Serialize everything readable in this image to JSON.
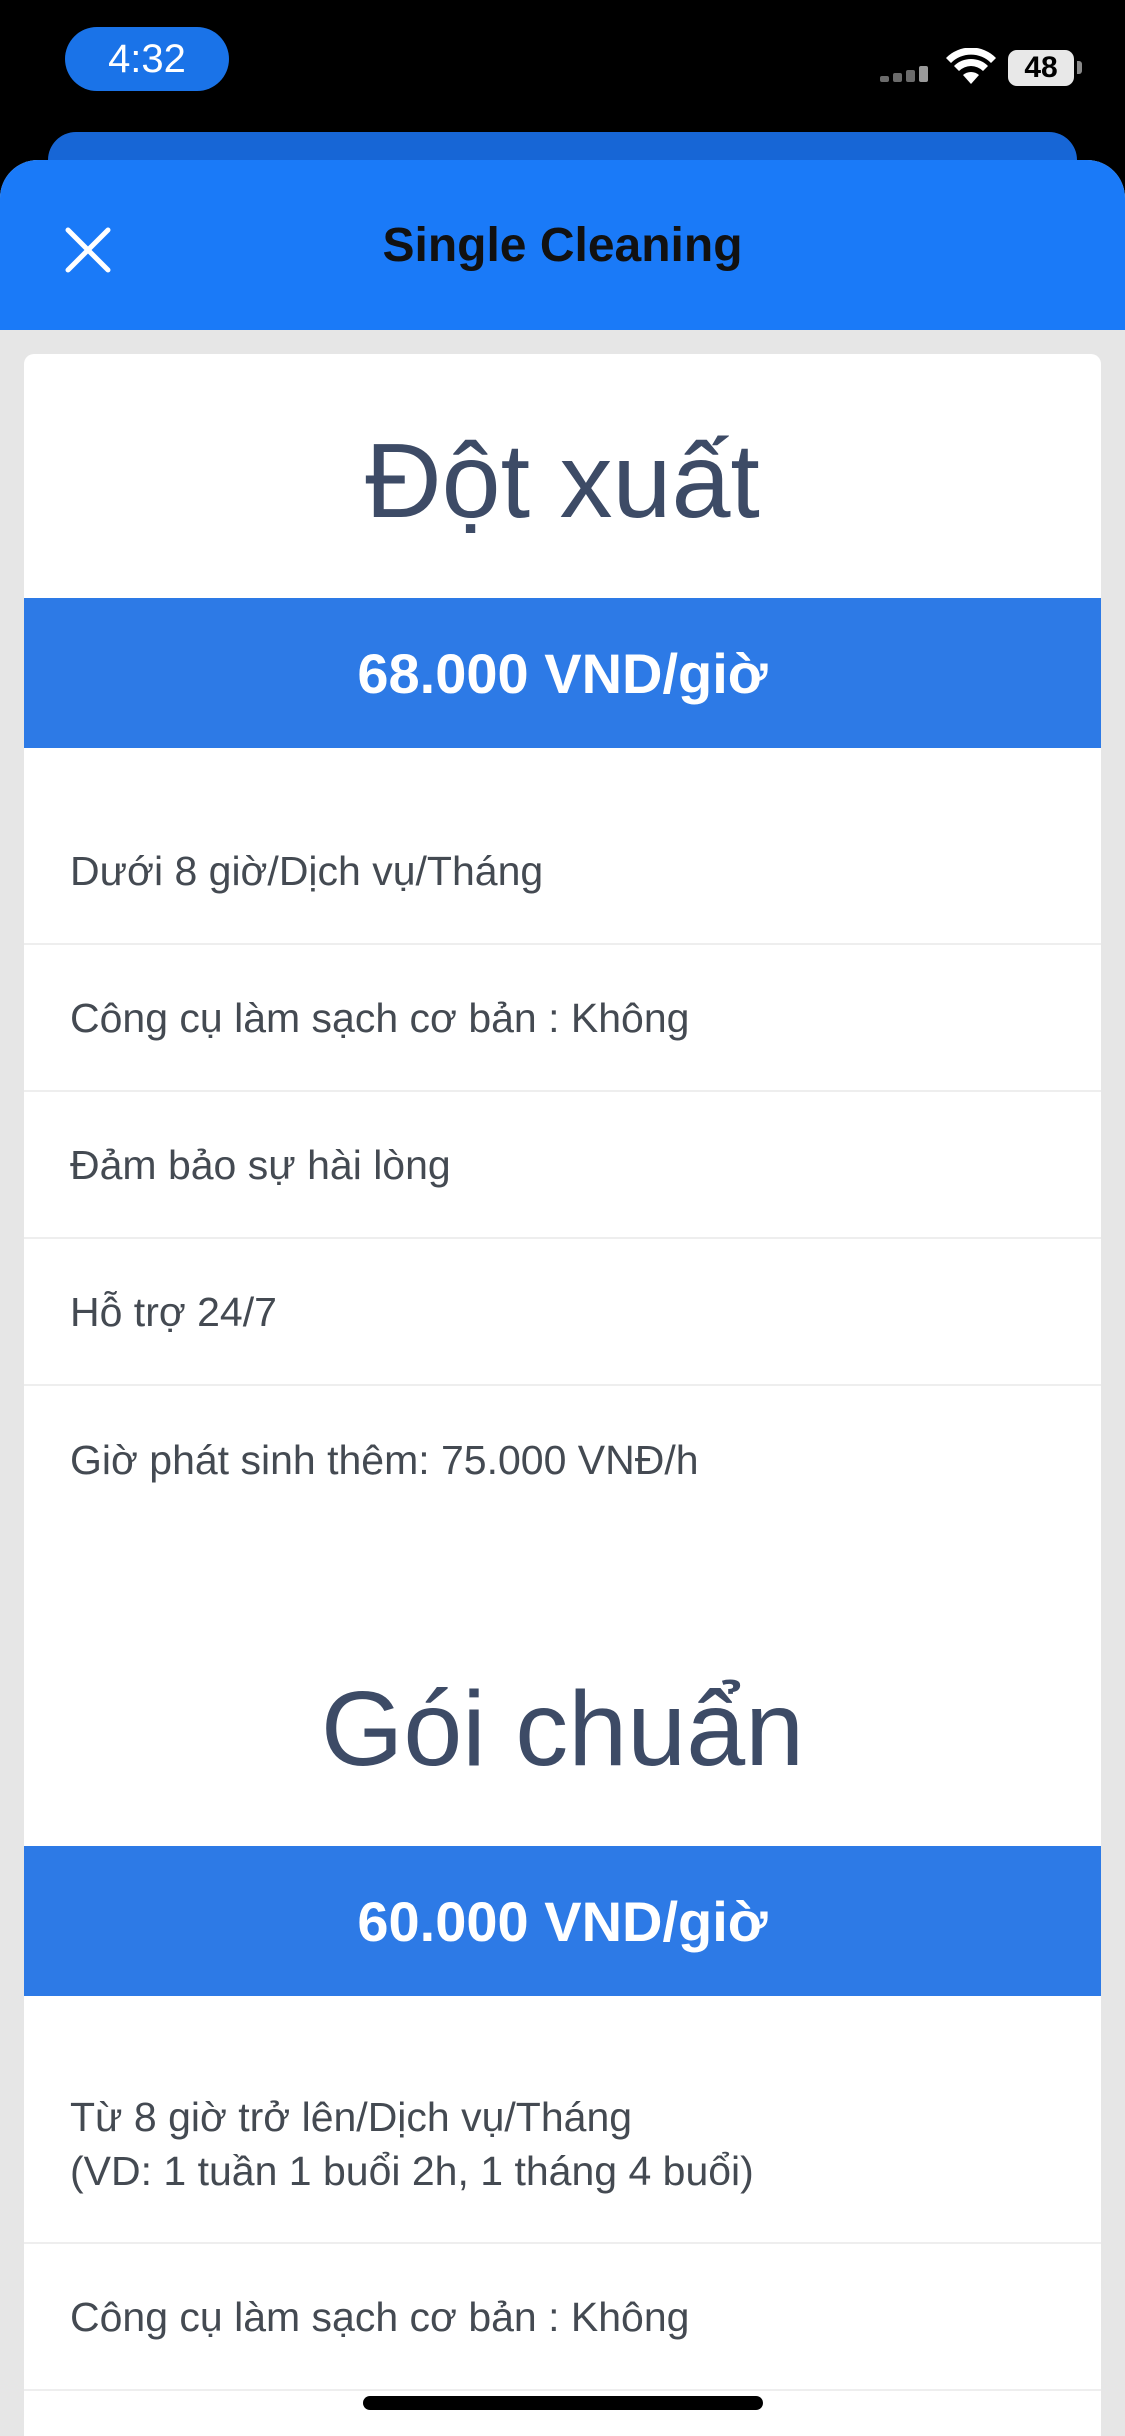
{
  "status_bar": {
    "time": "4:32",
    "battery": "48",
    "icons": [
      "signal-icon",
      "wifi-icon",
      "battery-icon"
    ]
  },
  "header": {
    "title": "Single Cleaning",
    "close_icon": "close-icon"
  },
  "colors": {
    "header": "#1a7af8",
    "price_bar": "#2d7ae6",
    "title_text": "#3d4b66",
    "page_bg": "#e6e6e6"
  },
  "plans": [
    {
      "title": "Đột xuất",
      "price": "68.000 VND/giờ",
      "features": [
        "Dưới 8 giờ/Dịch vụ/Tháng",
        "Công cụ làm sạch cơ bản : Không",
        "Đảm bảo sự hài lòng",
        "Hỗ trợ 24/7",
        "Giờ phát sinh thêm: 75.000 VNĐ/h"
      ]
    },
    {
      "title": "Gói chuẩn",
      "price": "60.000 VND/giờ",
      "features": [
        "Từ 8 giờ trở lên/Dịch vụ/Tháng",
        "(VD: 1 tuần 1 buổi 2h, 1 tháng 4 buổi)",
        "Công cụ làm sạch cơ bản : Không"
      ]
    }
  ]
}
